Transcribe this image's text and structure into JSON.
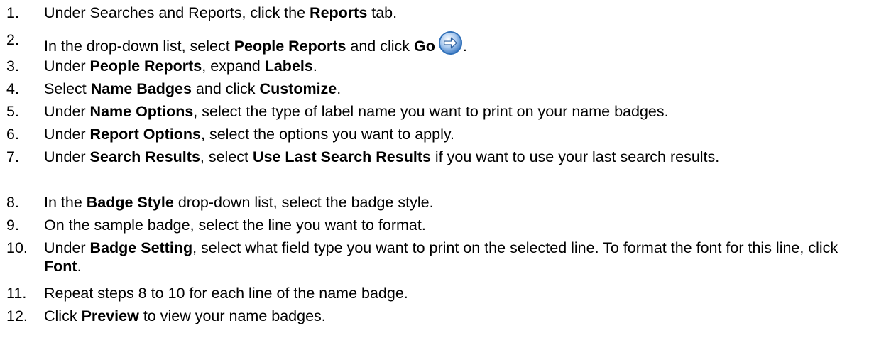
{
  "steps": [
    {
      "num": "1.",
      "parts": [
        {
          "t": "Under Searches and Reports, click the "
        },
        {
          "b": "Reports"
        },
        {
          "t": " tab."
        }
      ]
    },
    {
      "num": "2.",
      "parts": [
        {
          "t": "In the drop-down list, select "
        },
        {
          "b": "People Reports"
        },
        {
          "t": " and click "
        },
        {
          "b": "Go"
        },
        {
          "icon": "go-arrow-icon"
        },
        {
          "t": "."
        }
      ]
    },
    {
      "num": "3.",
      "parts": [
        {
          "t": "Under "
        },
        {
          "b": "People Reports"
        },
        {
          "t": ", expand "
        },
        {
          "b": "Labels"
        },
        {
          "t": "."
        }
      ]
    },
    {
      "num": "4.",
      "parts": [
        {
          "t": "Select "
        },
        {
          "b": "Name Badges"
        },
        {
          "t": " and click "
        },
        {
          "b": "Customize"
        },
        {
          "t": "."
        }
      ]
    },
    {
      "num": "5.",
      "parts": [
        {
          "t": "Under "
        },
        {
          "b": "Name Options"
        },
        {
          "t": ", select the type of label name you want to print on your name badges."
        }
      ]
    },
    {
      "num": "6.",
      "parts": [
        {
          "t": "Under "
        },
        {
          "b": "Report Options"
        },
        {
          "t": ", select the options you want to apply."
        }
      ]
    },
    {
      "num": "7.",
      "parts": [
        {
          "t": "Under "
        },
        {
          "b": "Search Results"
        },
        {
          "t": ", select "
        },
        {
          "b": "Use Last Search Results"
        },
        {
          "t": " if you want to use your last search results."
        }
      ]
    },
    {
      "num": "8.",
      "parts": [
        {
          "t": "In the "
        },
        {
          "b": "Badge Style"
        },
        {
          "t": " drop-down list, select the badge style."
        }
      ]
    },
    {
      "num": "9.",
      "parts": [
        {
          "t": "On the sample badge, select the line you want to format."
        }
      ]
    },
    {
      "num": "10.",
      "parts": [
        {
          "t": "Under "
        },
        {
          "b": "Badge Setting"
        },
        {
          "t": ", select what field type you want to print on the selected line. To format the font for this line, click "
        },
        {
          "b": "Font"
        },
        {
          "t": "."
        }
      ]
    },
    {
      "num": "11.",
      "parts": [
        {
          "t": "Repeat steps 8 to 10 for each line of the name badge."
        }
      ]
    },
    {
      "num": "12.",
      "parts": [
        {
          "t": "Click "
        },
        {
          "b": "Preview"
        },
        {
          "t": " to view your name badges."
        }
      ]
    }
  ],
  "icons": {
    "go_arrow": {
      "name": "go-arrow-icon",
      "ring": "#2f6fb8",
      "fill": "#7fb0e6",
      "arrow": "#ffffff"
    }
  }
}
